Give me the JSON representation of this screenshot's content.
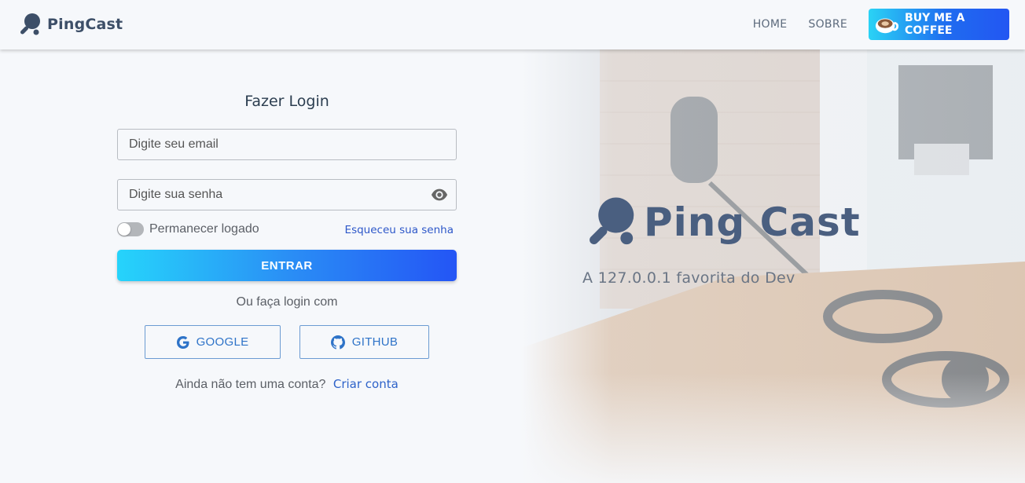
{
  "header": {
    "brand": "PingCast",
    "nav": [
      {
        "label": "HOME"
      },
      {
        "label": "SOBRE"
      }
    ],
    "coffee_label": "BUY ME A COFFEE"
  },
  "login": {
    "title": "Fazer Login",
    "email_placeholder": "Digite seu email",
    "password_placeholder": "Digite sua senha",
    "remember_label": "Permanecer logado",
    "forgot_label": "Esqueceu sua senha",
    "submit_label": "ENTRAR",
    "or_label": "Ou faça login com",
    "google_label": "GOOGLE",
    "github_label": "GITHUB",
    "signup_question": "Ainda não tem uma conta?",
    "signup_link": "Criar conta"
  },
  "hero": {
    "title": "Ping Cast",
    "tagline": "A 127.0.0.1 favorita do Dev"
  },
  "colors": {
    "accent_start": "#26d4fb",
    "accent_end": "#2455f5",
    "brand": "#4a5f80",
    "link": "#2d57c9"
  },
  "icons": [
    "ping-pong-icon",
    "coffee-cup-icon",
    "eye-icon",
    "google-icon",
    "github-icon"
  ]
}
